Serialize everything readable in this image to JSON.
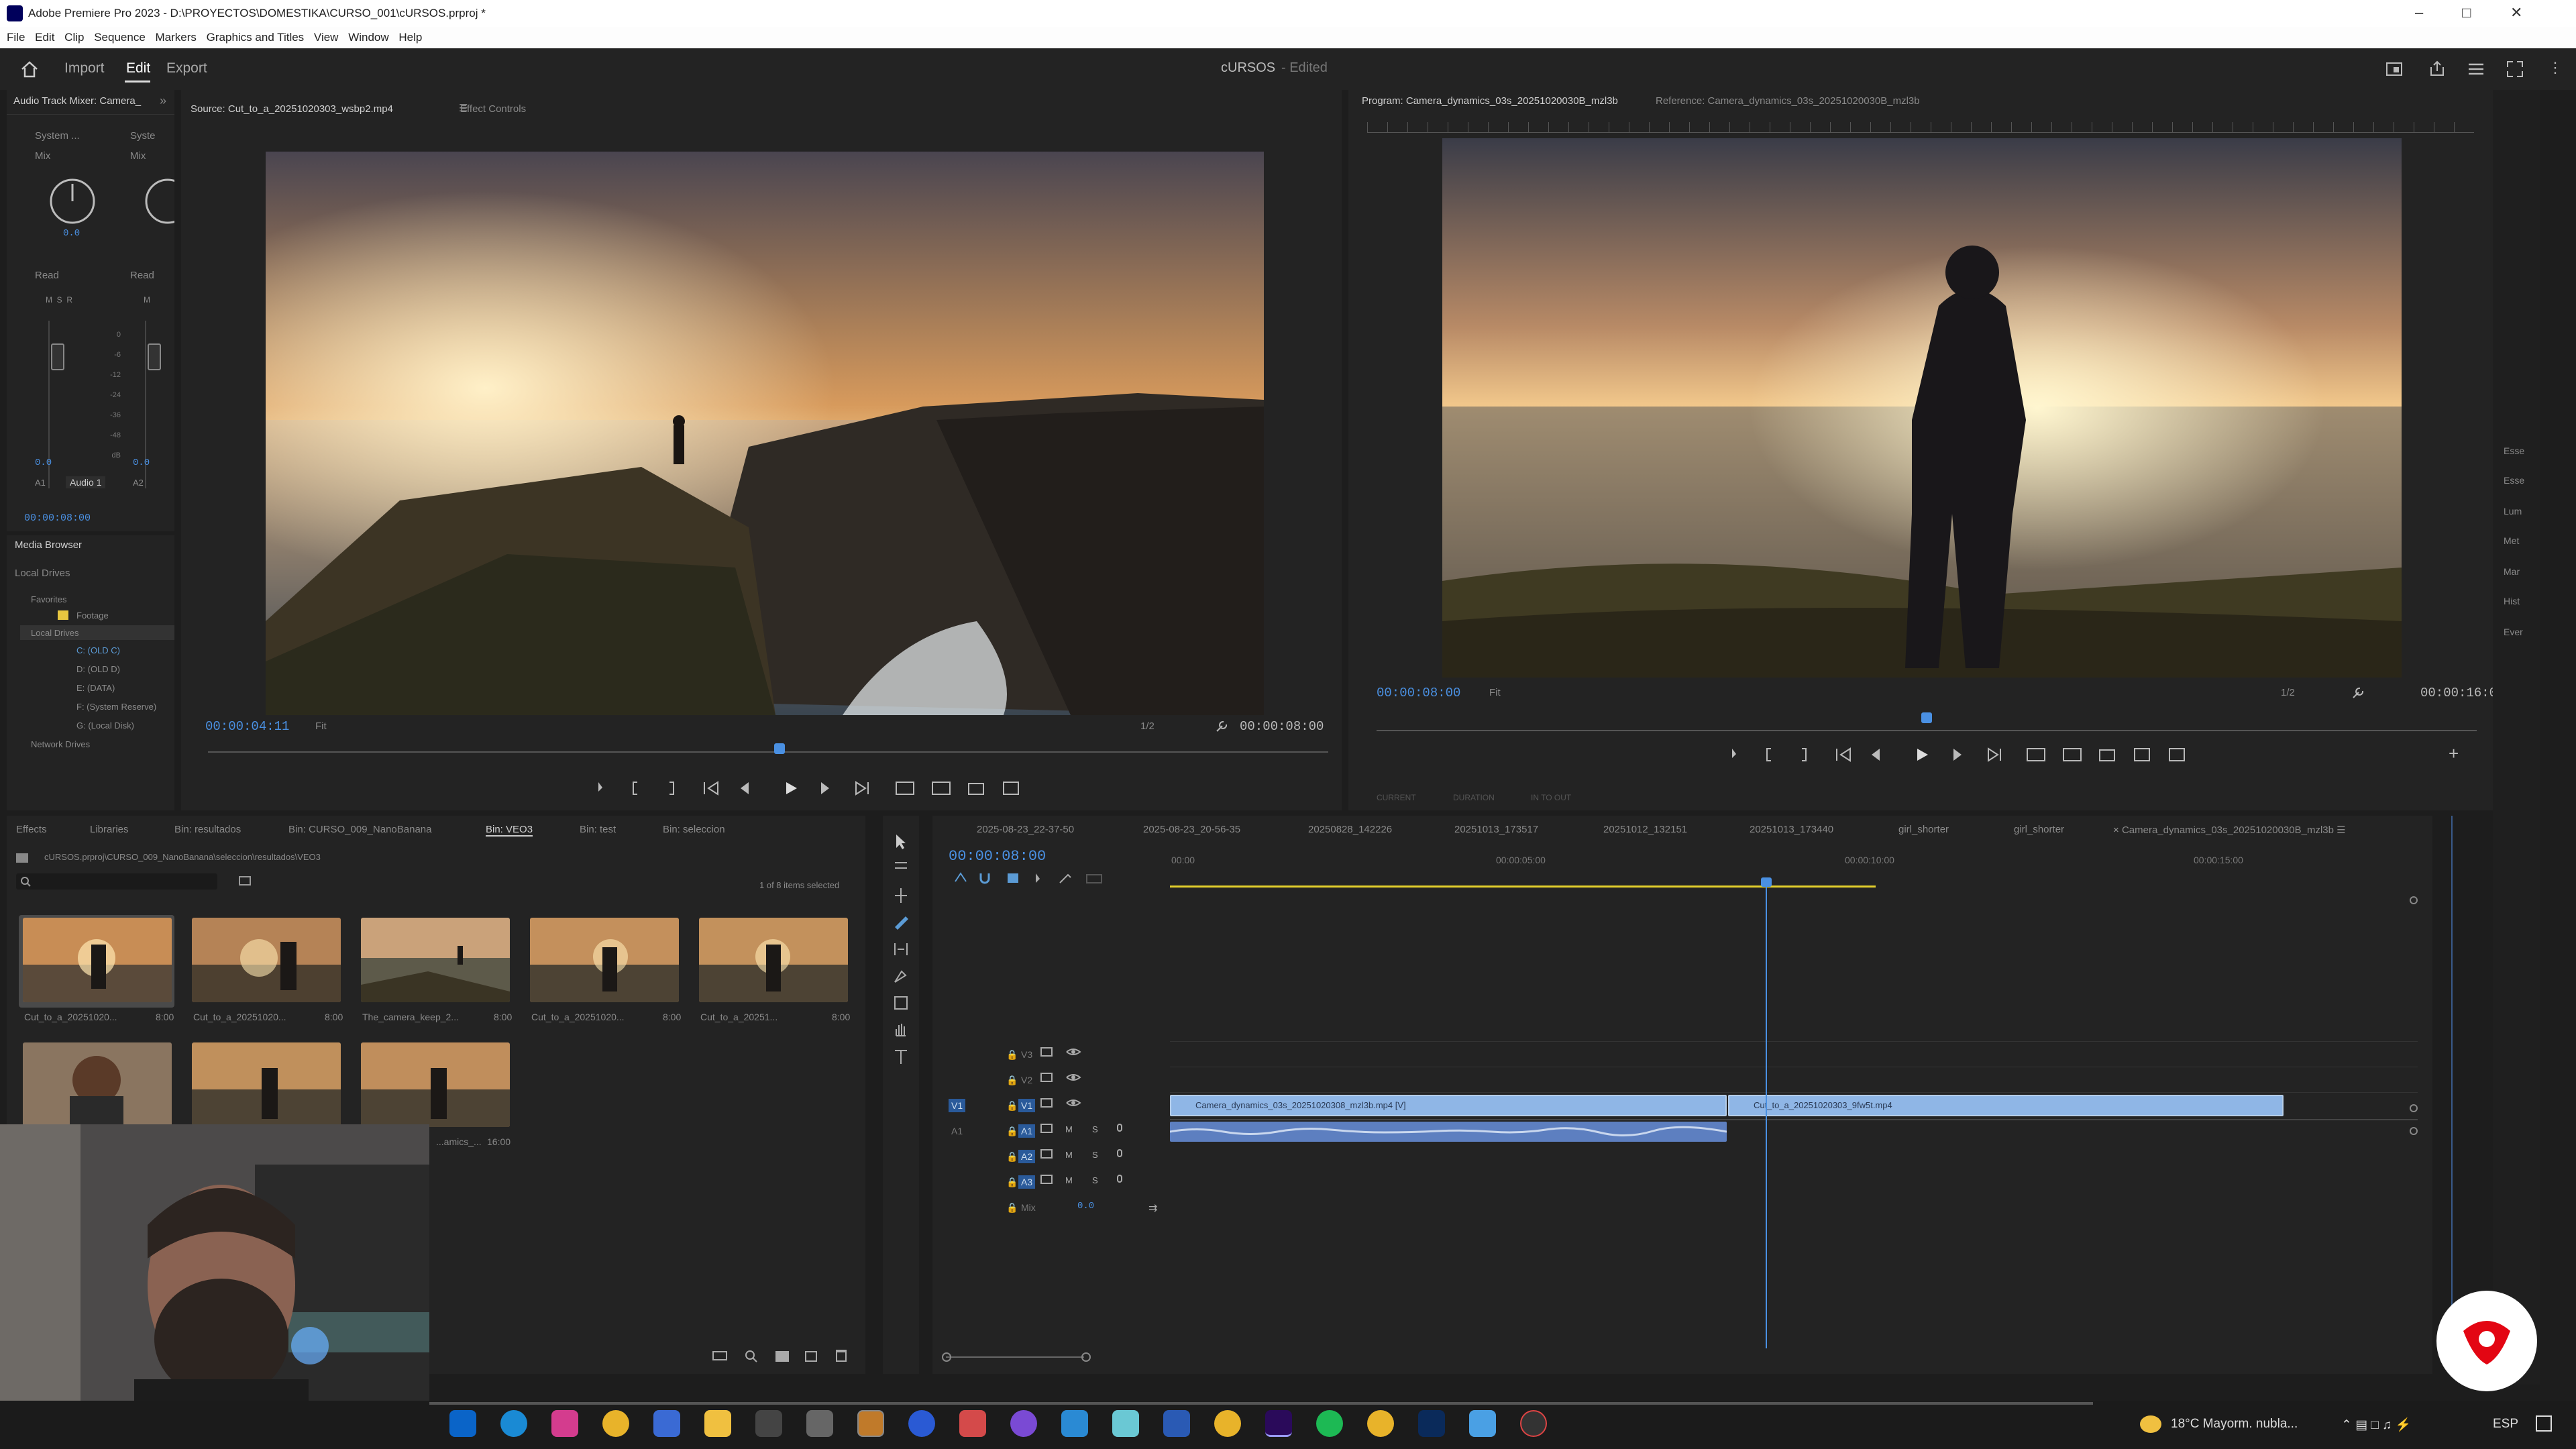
{
  "window": {
    "title": "Adobe Premiere Pro 2023 - D:\\PROYECTOS\\DOMESTIKA\\CURSO_001\\cURSOS.prproj *"
  },
  "menu": [
    "File",
    "Edit",
    "Clip",
    "Sequence",
    "Markers",
    "Graphics and Titles",
    "View",
    "Window",
    "Help"
  ],
  "workspace": {
    "tabs": [
      "Import",
      "Edit",
      "Export"
    ],
    "project_name": "cURSOS",
    "status": "- Edited"
  },
  "audio_mixer": {
    "tab": "Audio Track Mixer: Camera_",
    "ch1": {
      "top": "System ...",
      "mode": "Mix",
      "value": "0.0",
      "auto": "Read",
      "name": "Audio 1",
      "label": "A1"
    },
    "ch2": {
      "top": "Syste",
      "mode": "Mix",
      "value": "0.0",
      "auto": "Read",
      "label": "A2"
    },
    "timecode": "00:00:08:00",
    "scale": [
      "0",
      "-6",
      "-12",
      "-24",
      "-36",
      "-48",
      "dB"
    ]
  },
  "media_browser": {
    "tab": "Media Browser",
    "location": "Local Drives",
    "favorites": "Favorites",
    "footage": "Footage",
    "local_drives": "Local Drives",
    "drives": [
      "C: (OLD C)",
      "D: (OLD D)",
      "E: (DATA)",
      "F: (System Reserve)",
      "G: (Local Disk)"
    ],
    "network": "Network Drives"
  },
  "source": {
    "tab": "Source: Cut_to_a_20251020303_wsbp2.mp4",
    "tab2": "Effect Controls",
    "timecode": "00:00:04:11",
    "fit": "Fit",
    "fraction": "1/2",
    "duration": "00:00:08:00",
    "playhead": 0.51
  },
  "program": {
    "tab": "Program: Camera_dynamics_03s_20251020030B_mzl3b",
    "tab2": "Reference: Camera_dynamics_03s_20251020030B_mzl3b",
    "timecode": "00:00:08:00",
    "fit": "Fit",
    "fraction": "1/2",
    "duration": "00:00:16:00",
    "playhead": 0.5,
    "bottom_tabs": [
      "CURRENT",
      "DURATION",
      "IN TO OUT"
    ]
  },
  "project": {
    "tabs": [
      "Effects",
      "Libraries",
      "Bin: resultados",
      "Bin: CURSO_009_NanoBanana",
      "Bin: VEO3",
      "Bin: test",
      "Bin: seleccion"
    ],
    "path": "cURSOS.prproj\\CURSO_009_NanoBanana\\seleccion\\resultados\\VEO3",
    "selected": "1 of 8 items selected",
    "items": [
      {
        "name": "Cut_to_a_20251020...",
        "dur": "8:00"
      },
      {
        "name": "Cut_to_a_20251020...",
        "dur": "8:00"
      },
      {
        "name": "The_camera_keep_2...",
        "dur": "8:00"
      },
      {
        "name": "Cut_to_a_20251020...",
        "dur": "8:00"
      },
      {
        "name": "Cut_to_a_20251...",
        "dur": "8:00"
      },
      {
        "name": "",
        "dur": ""
      },
      {
        "name": "",
        "dur": ""
      },
      {
        "name": "...amics_...",
        "dur": "16:00"
      }
    ]
  },
  "timeline": {
    "tabs": [
      "2025-08-23_22-37-50",
      "2025-08-23_20-56-35",
      "20250828_142226",
      "20251013_173517",
      "20251012_132151",
      "20251013_173440",
      "girl_shorter",
      "girl_shorter",
      "Camera_dynamics_03s_20251020030B_mzl3b"
    ],
    "timecode": "00:00:08:00",
    "ruler": [
      "00:00",
      "00:00:05:00",
      "00:00:10:00",
      "00:00:15:00"
    ],
    "video_tracks": [
      "V3",
      "V2",
      "V1"
    ],
    "audio_tracks": [
      "A1",
      "A2",
      "A3"
    ],
    "mix_label": "Mix",
    "mix_value": "0.0",
    "source_v": "V1",
    "source_a": "A1",
    "clip1": "Camera_dynamics_03s_20251020308_mzl3b.mp4 [V]",
    "clip2": "Cut_to_a_20251020303_9fw5t.mp4",
    "playhead_fraction": 0.475
  },
  "right_panel": [
    "Esse",
    "Esse",
    "Lum",
    "Met",
    "Mar",
    "Hist",
    "Ever"
  ],
  "taskbar": {
    "weather": "18°C  Mayorm. nubla...",
    "lang": "ESP"
  },
  "colors": {
    "accent": "#4a90e2",
    "clip_video": "#8fb6e6",
    "clip_audio": "#5d7fc0",
    "work_area": "#e5d12c"
  }
}
